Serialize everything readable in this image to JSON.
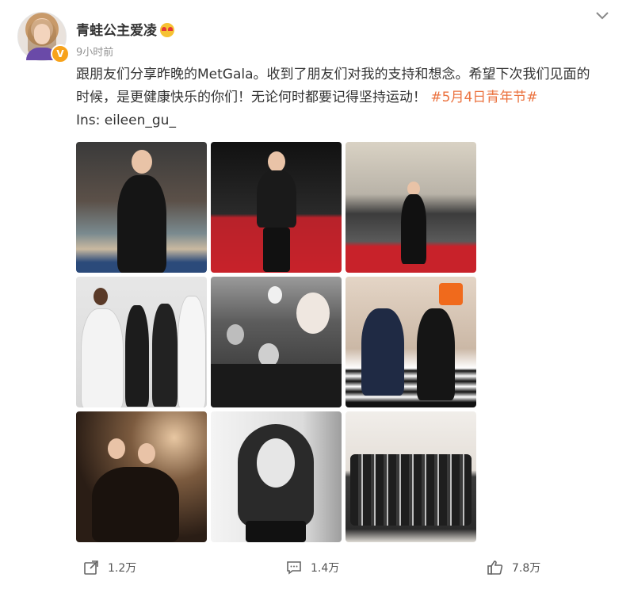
{
  "post": {
    "author": "青蛙公主爱凌",
    "verified_badge": "V",
    "time": "9小时前",
    "text_line1": "跟朋友们分享昨晚的MetGala。收到了朋友们对我的支持和想念。希望下次我们见面的",
    "text_line2_prefix": "时候，是更健康快乐的你们！无论何时都要记得坚持运动！",
    "hashtag": "#5月4日青年节#",
    "ins": "Ins: eileen_gu_"
  },
  "icons": {
    "menu": "chevron-down-icon",
    "share": "share-icon",
    "comment": "comment-icon",
    "like": "thumb-up-icon"
  },
  "actions": {
    "share_count": "1.2万",
    "comment_count": "1.4万",
    "like_count": "7.8万"
  },
  "colors": {
    "hashtag": "#eb7340",
    "verified": "#f7a21b",
    "red_carpet": "#c8222a"
  }
}
